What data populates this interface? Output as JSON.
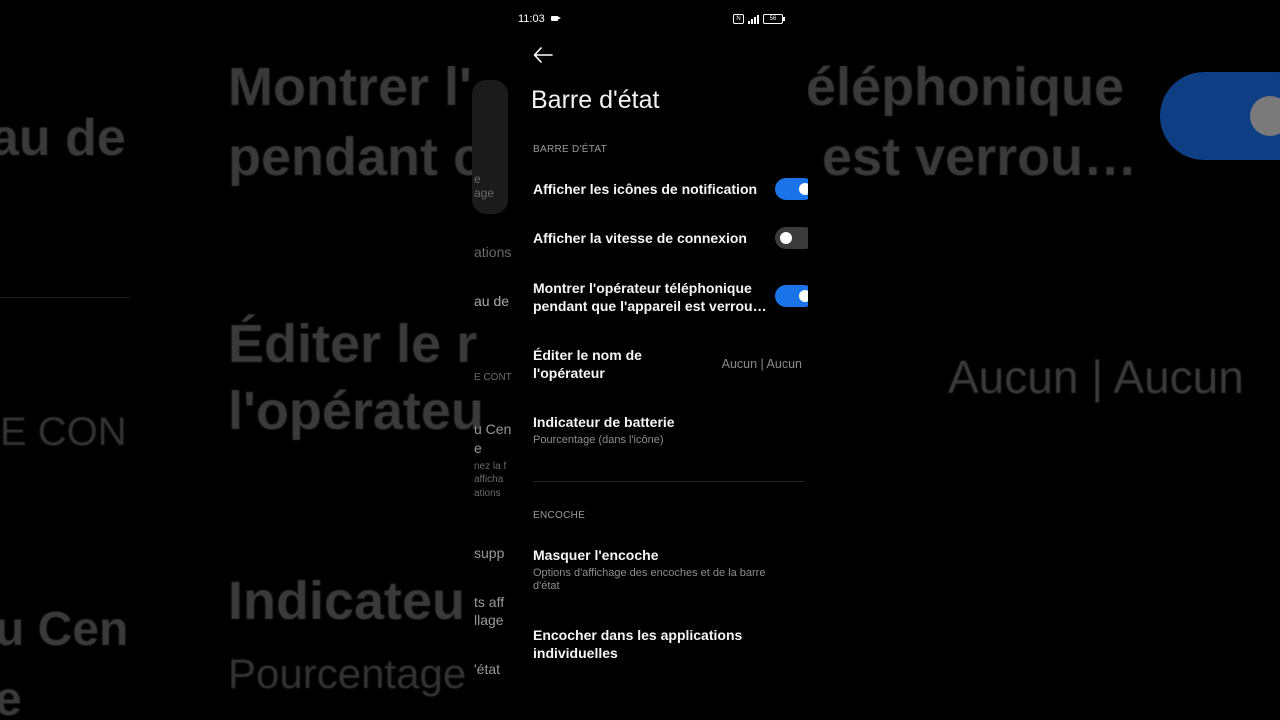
{
  "status_bar": {
    "time": "11:03",
    "nfc": "N",
    "battery": "56"
  },
  "page": {
    "title": "Barre d'état"
  },
  "sections": {
    "status_bar": "BARRE D'ÉTAT",
    "notch": "ENCOCHE"
  },
  "settings": {
    "notification_icons": {
      "label": "Afficher les icônes de notification",
      "enabled": true
    },
    "connection_speed": {
      "label": "Afficher la vitesse de connexion",
      "enabled": false
    },
    "carrier_name_locked": {
      "label": "Montrer l'opérateur téléphonique pendant que l'appareil est verrou…",
      "enabled": true
    },
    "edit_carrier": {
      "label": "Éditer le nom de l'opérateur",
      "value": "Aucun | Aucun"
    },
    "battery_indicator": {
      "label": "Indicateur de batterie",
      "sub": "Pourcentage (dans l'icône)"
    },
    "hide_notch": {
      "label": "Masquer l'encoche",
      "sub": "Options d'affichage des encoches et de la barre d'état"
    },
    "notch_apps": {
      "label": "Encocher dans les applications individuelles"
    }
  },
  "background": {
    "large_1": "Montrer l'",
    "large_2": "pendant c",
    "large_3": "éléphonique",
    "large_4": "est verrou…",
    "large_5": "Éditer le r",
    "large_6": "l'opérateu",
    "large_7": "Indicateu",
    "large_8": "Pourcentage",
    "large_9": "Aucun | Aucun",
    "left_1": "au de",
    "left_2": "E CON",
    "left_3": "u Cen",
    "left_4": "e",
    "small_1": "e",
    "small_2": "age",
    "small_3": "ations",
    "small_4": "au de",
    "small_5": "E CONT",
    "small_6": "u Cen",
    "small_7": "e",
    "small_8": "nez la f",
    "small_9": "afficha",
    "small_10": "ations",
    "small_11": "supp",
    "small_12": "ts aff",
    "small_13": "llage",
    "small_14": "'état"
  },
  "colors": {
    "toggle_on": "#1a73e8",
    "toggle_off": "#3b3b3b",
    "background": "#000000"
  }
}
